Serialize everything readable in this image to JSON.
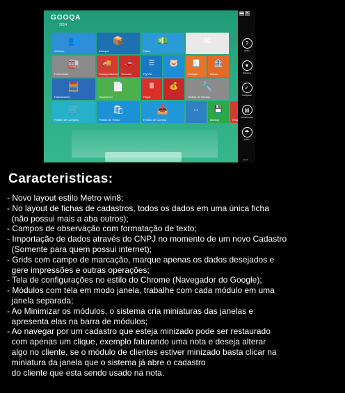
{
  "app": {
    "logo": "GOOQA",
    "logo_sub": "2014",
    "tiles": [
      {
        "label": "Clientes",
        "icon": "👥",
        "color": "#2e8fd6"
      },
      {
        "label": "Estoque",
        "icon": "📦",
        "color": "#1f6fb3"
      },
      {
        "label": "Caixa",
        "icon": "💵",
        "color": "#2b9ad8"
      },
      {
        "label": "",
        "icon": "✉",
        "color": "#e9e9e9"
      },
      {
        "label": "Fornecedor",
        "icon": "🏭",
        "color": "#8a8a8a"
      },
      {
        "label": "Transportadora",
        "icon": "🚚",
        "color": "#d63c2e"
      },
      {
        "label": "Veículos",
        "icon": "🚗",
        "color": "#c9302c"
      },
      {
        "label": "Pg.Vist",
        "icon": "☰",
        "color": "#1778c4"
      },
      {
        "label": "",
        "icon": "🐷",
        "color": "#1d8fd8"
      },
      {
        "label": "Cheque",
        "icon": "🧾",
        "color": "#e8732c"
      },
      {
        "label": "Banco",
        "icon": "🏦",
        "color": "#e06b28"
      },
      {
        "label": "Faturamento",
        "icon": "🧮",
        "color": "#2a6ab8"
      },
      {
        "label": "Orçamento",
        "icon": "📄",
        "color": "#4db04a"
      },
      {
        "label": "Pagar",
        "icon": "🖩",
        "color": "#d9302a"
      },
      {
        "label": "",
        "icon": "💰",
        "color": "#c8272a"
      },
      {
        "label": "Ordem de Serviço",
        "icon": "🔧",
        "color": "#8b8b8b"
      },
      {
        "label": "Pedido de Compras",
        "icon": "🛒",
        "color": "#25b1c9"
      },
      {
        "label": "Pedido de Venda",
        "icon": "🛍",
        "color": "#1d91d6"
      },
      {
        "label": "Pedido de Compra",
        "icon": "📥",
        "color": "#2196d9"
      },
      {
        "label": "",
        "icon": "↔",
        "color": "#2f7fc4"
      },
      {
        "label": "Backup",
        "icon": "💾",
        "color": "#2ba84a"
      },
      {
        "label": "Resposta Fiscais",
        "icon": "📋",
        "color": "#d23b2e"
      }
    ],
    "rail": [
      {
        "icon": "?",
        "label": "Ajuda"
      },
      {
        "icon": "♥",
        "label": "Reforma"
      },
      {
        "icon": "✓",
        "label": "Configurar"
      },
      {
        "icon": "▤",
        "label": "Ferramentas"
      },
      {
        "icon": "☂",
        "label": "Sobre"
      }
    ],
    "window_buttons": [
      "▬",
      "✕"
    ],
    "clock": "12:00"
  },
  "heading": "Caracteristicas:",
  "features": [
    "- Novo layout estilo Metro win8;",
    "- No layout de fichas de cadastros, todos os dados em uma única ficha",
    "  (não possui mais a aba outros);",
    "- Campos de observação com formatação de texto;",
    "- Importação de dados através do CNPJ no momento de um novo Cadastro",
    "  (Somente para quem possui internet);",
    "- Grids com campo de marcação, marque apenas os dados desejados e",
    "  gere impressões e outras operações;",
    "- Tela de configurações no estilo do Chrome (Navegador do Google);",
    "- Módulos com tela em modo janela, trabalhe com cada módulo em uma",
    "  janela separada;",
    "- Ao Minimizar os módulos, o sistema cria miniaturas das janelas e",
    "  apresenta elas na barra de módulos;",
    "- Ao navegar por um cadastro que esteja minizado pode ser restaurado",
    "  com apenas um clique, exemplo faturando uma nota e deseja alterar",
    "  algo no cliente, se o módulo de clientes estiver minizado basta clicar na",
    "  miniatura da janela que o sistema já abre o cadastro",
    "  do cliente que esta sendo usado na nota."
  ]
}
